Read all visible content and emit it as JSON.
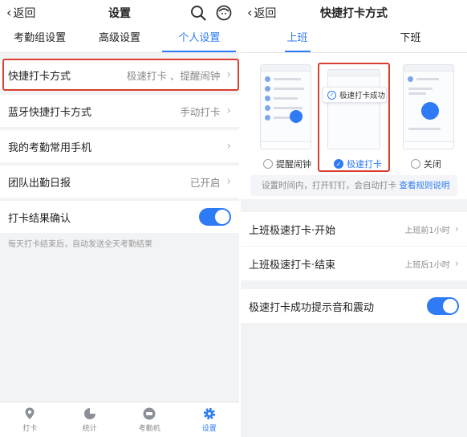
{
  "colors": {
    "accent": "#2f7bf5",
    "highlight": "#d9402f",
    "background": "#f2f3f5"
  },
  "left": {
    "header": {
      "back_label": "返回",
      "title": "设置",
      "icons": [
        "search-icon",
        "avatar-icon"
      ]
    },
    "tabs": [
      {
        "label": "考勤组设置"
      },
      {
        "label": "高级设置"
      },
      {
        "label": "个人设置",
        "active": true
      }
    ],
    "rows": [
      {
        "label": "快捷打卡方式",
        "value": "极速打卡 、提醒闹钟",
        "highlighted": true
      },
      {
        "label": "蓝牙快捷打卡方式",
        "value": "手动打卡"
      },
      {
        "label": "我的考勤常用手机",
        "value": ""
      },
      {
        "label": "团队出勤日报",
        "value": "已开启"
      },
      {
        "label": "打卡结果确认",
        "toggle": true
      }
    ],
    "hint": "每天打卡结束后，自动发送全天考勤结果",
    "bottom_nav": [
      {
        "label": "打卡",
        "icon": "location-pin-icon"
      },
      {
        "label": "统计",
        "icon": "pie-chart-icon"
      },
      {
        "label": "考勤机",
        "icon": "attendance-machine-icon"
      },
      {
        "label": "设置",
        "icon": "gear-icon",
        "active": true
      }
    ]
  },
  "right": {
    "header": {
      "back_label": "返回",
      "title": "快捷打卡方式"
    },
    "tabs": [
      {
        "label": "上班",
        "active": true
      },
      {
        "label": "下班"
      }
    ],
    "preview_toast": "极速打卡成功",
    "options": [
      {
        "label": "提醒闹钟",
        "selected": false
      },
      {
        "label": "极速打卡",
        "selected": true
      },
      {
        "label": "关闭",
        "selected": false
      }
    ],
    "info_text": "设置时间内，打开钉钉，会自动打卡",
    "info_link": "查看规则说明",
    "rows": [
      {
        "label": "上班极速打卡·开始",
        "value": "上班前1小时"
      },
      {
        "label": "上班极速打卡·结束",
        "value": "上班后1小时"
      },
      {
        "label": "极速打卡成功提示音和震动",
        "toggle": true
      }
    ]
  }
}
